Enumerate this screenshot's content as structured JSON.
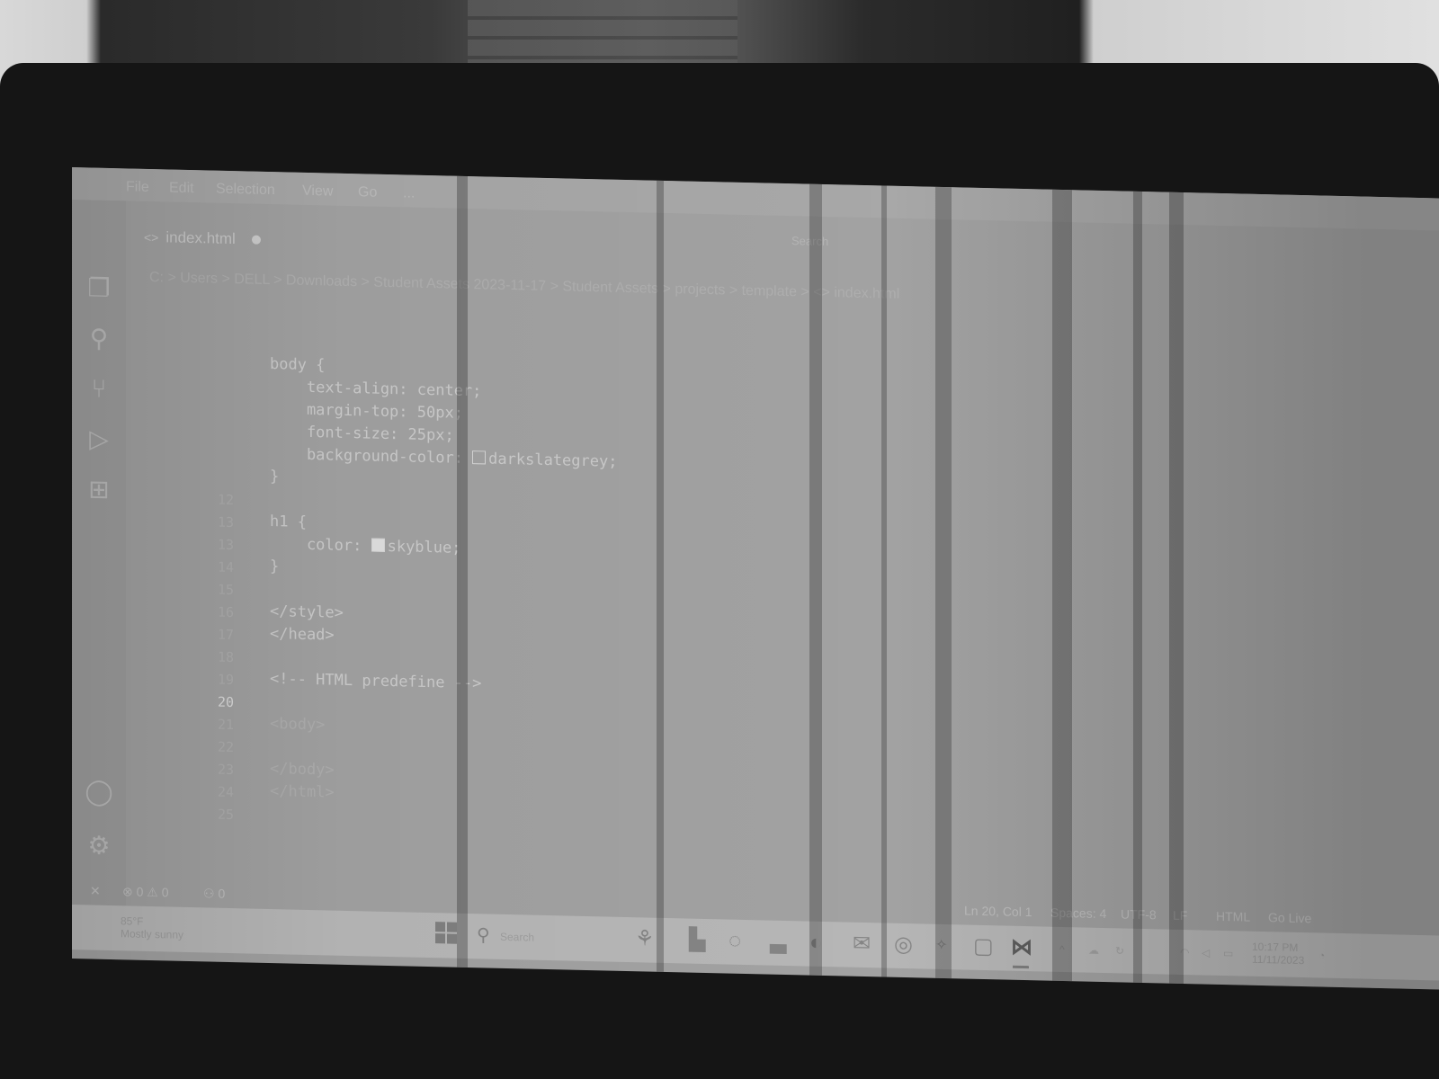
{
  "menubar": {
    "items": [
      "File",
      "Edit",
      "Selection",
      "View",
      "Go",
      "..."
    ],
    "search_label": "Search"
  },
  "tab": {
    "label": "index.html",
    "icon": "html-angle-icon"
  },
  "breadcrumb": "C: > Users > DELL > Downloads > Student Assets 2023-11-17 > Student Assets > projects > template > <> index.html",
  "editor": {
    "lines": [
      {
        "num": "",
        "text": "body {"
      },
      {
        "num": "",
        "text": "    text-align: center;"
      },
      {
        "num": "",
        "text": "    margin-top: 50px;"
      },
      {
        "num": "",
        "text": "    font-size: 25px;"
      },
      {
        "num": "",
        "text": "    background-color: ",
        "swatch": "darkslategrey",
        "after": "darkslategrey;"
      },
      {
        "num": "",
        "text": "}"
      },
      {
        "num": "12",
        "text": ""
      },
      {
        "num": "13",
        "text": "h1 {"
      },
      {
        "num": "13",
        "text": "    color: ",
        "swatch": "skyblue",
        "after": "skyblue;"
      },
      {
        "num": "14",
        "text": "}"
      },
      {
        "num": "15",
        "text": ""
      },
      {
        "num": "16",
        "text": "</style>"
      },
      {
        "num": "17",
        "text": "</head>"
      },
      {
        "num": "18",
        "text": ""
      },
      {
        "num": "19",
        "text": "<!-- HTML predefine -->"
      },
      {
        "num": "20",
        "text": ""
      },
      {
        "num": "21",
        "text": "<body>"
      },
      {
        "num": "22",
        "text": ""
      },
      {
        "num": "23",
        "text": "</body>"
      },
      {
        "num": "24",
        "text": "</html>"
      },
      {
        "num": "25",
        "text": ""
      }
    ],
    "active_line": "20"
  },
  "statusbar": {
    "errors": "0",
    "warnings": "0",
    "ports": "0",
    "position": "Ln 20, Col 1",
    "spaces": "Spaces: 4",
    "encoding": "UTF-8",
    "eol": "LF",
    "language": "HTML",
    "golive": "Go Live"
  },
  "taskbar": {
    "weather": "85°F",
    "weather_sub": "Mostly sunny",
    "search_label": "Search",
    "time": "10:17 PM",
    "date": "11/11/2023"
  }
}
